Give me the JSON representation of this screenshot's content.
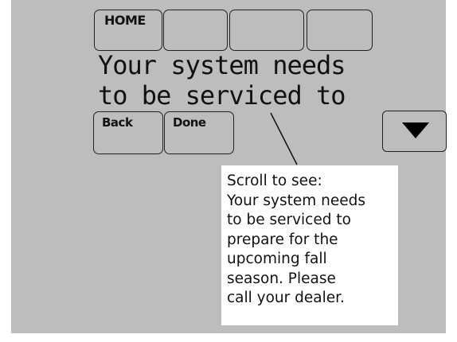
{
  "top_buttons": {
    "home_label": "HOME"
  },
  "display": {
    "line1": "Your system needs",
    "line2": "to be serviced to"
  },
  "bottom_buttons": {
    "back_label": "Back",
    "done_label": "Done"
  },
  "scroll_button": {
    "icon": "down-arrow-icon"
  },
  "callout": {
    "lines": [
      "Scroll to see:",
      "Your system needs",
      "to be serviced to",
      "prepare for the",
      "upcoming fall",
      "season. Please",
      "call your dealer."
    ]
  }
}
